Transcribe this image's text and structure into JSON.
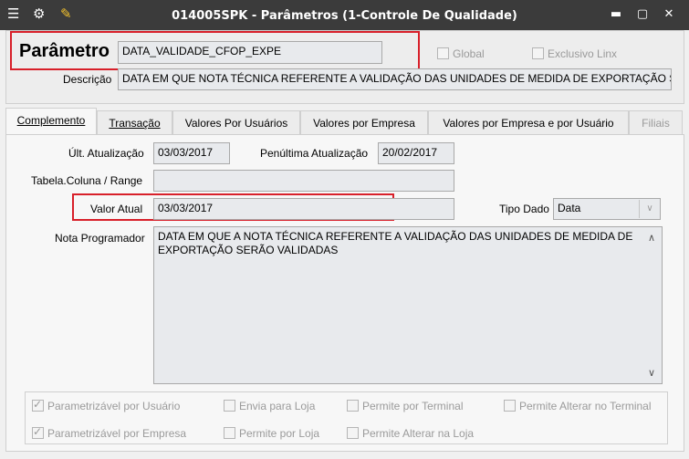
{
  "window": {
    "title": "014005SPK - Parâmetros (1-Controle De Qualidade)",
    "icons": [
      "menu-icon",
      "traffic-light-icon",
      "wrench-icon"
    ],
    "controls": [
      "minimize-icon",
      "maximize-icon",
      "close-icon"
    ]
  },
  "header": {
    "parametro_label": "Parâmetro",
    "parametro_value": "DATA_VALIDADE_CFOP_EXPE",
    "global_label": "Global",
    "exclusivo_label": "Exclusivo Linx",
    "descricao_label": "Descrição",
    "descricao_value": "DATA EM QUE NOTA TÉCNICA REFERENTE A VALIDAÇÃO DAS UNIDADES DE MEDIDA DE EXPORTAÇÃO SERÃO VALIDADAS"
  },
  "tabs": [
    {
      "label": "Complemento",
      "active": true
    },
    {
      "label": "Transação"
    },
    {
      "label": "Valores Por Usuários"
    },
    {
      "label": "Valores por Empresa"
    },
    {
      "label": "Valores por Empresa e por Usuário"
    },
    {
      "label": "Filiais",
      "disabled": true
    }
  ],
  "complemento": {
    "ult_atualizacao_label": "Últ. Atualização",
    "ult_atualizacao_value": "03/03/2017",
    "penultima_label": "Penúltima Atualização",
    "penultima_value": "20/02/2017",
    "tabela_label": "Tabela.Coluna / Range",
    "tabela_value": "",
    "valor_atual_label": "Valor Atual",
    "valor_atual_value": "03/03/2017",
    "tipo_dado_label": "Tipo Dado",
    "tipo_dado_value": "Data",
    "nota_label": "Nota Programador",
    "nota_value": "DATA EM QUE A NOTA TÉCNICA REFERENTE A VALIDAÇÃO DAS UNIDADES DE MEDIDA DE EXPORTAÇÃO SERÃO VALIDADAS"
  },
  "options": [
    {
      "label": "Parametrizável por Usuário",
      "checked": true
    },
    {
      "label": "Envia para Loja",
      "checked": false
    },
    {
      "label": "Permite por Terminal",
      "checked": false
    },
    {
      "label": "Permite Alterar no Terminal",
      "checked": false
    },
    {
      "label": "Parametrizável por Empresa",
      "checked": true
    },
    {
      "label": "Permite por Loja",
      "checked": false
    },
    {
      "label": "Permite Alterar na Loja",
      "checked": false
    }
  ],
  "colors": {
    "titlebar": "#3b3b3b",
    "highlight": "#d8202a",
    "field_bg": "#e8eaed"
  }
}
